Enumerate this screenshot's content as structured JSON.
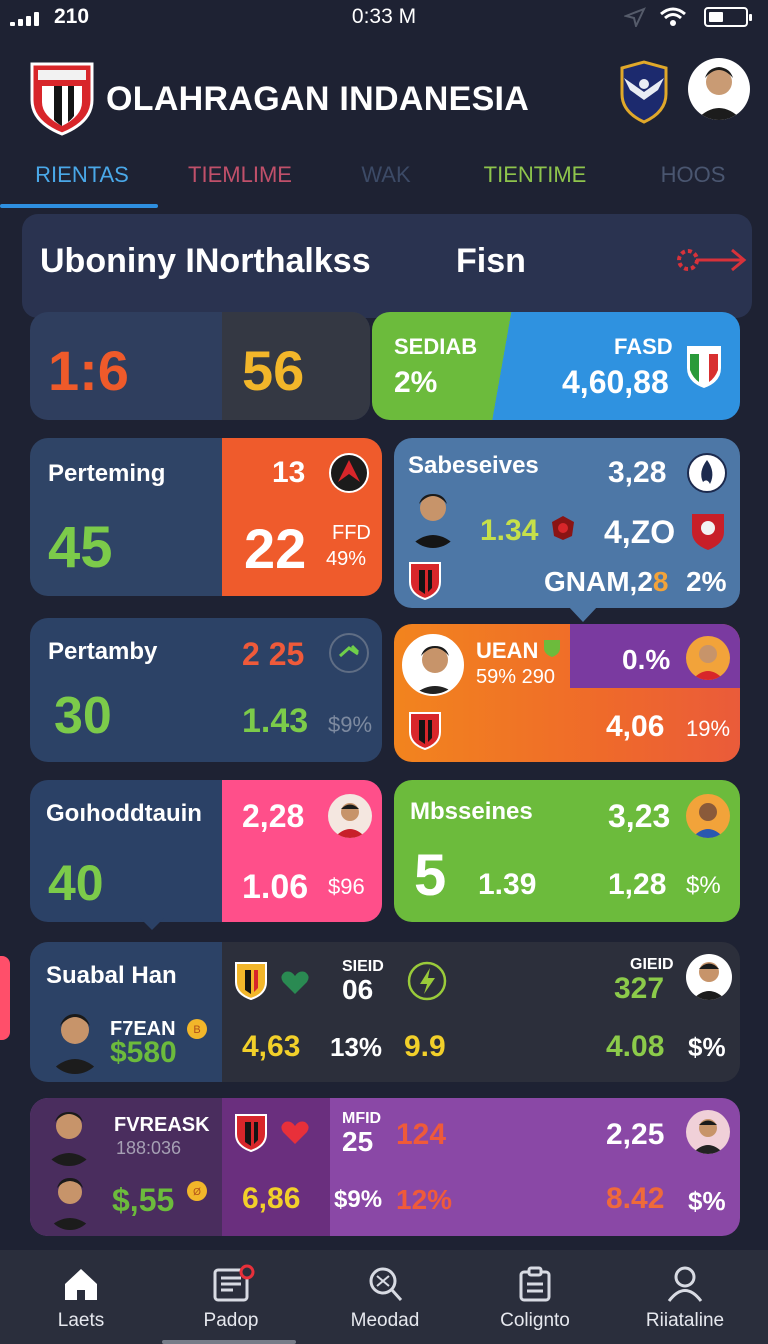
{
  "status_bar": {
    "carrier": "210",
    "time": "0:33 M",
    "battery_level_pct": 40
  },
  "header": {
    "title": "OLAHRAGAN INDANESIA",
    "logo_icon": "team-shield-icon",
    "badge_icon": "eagle-crest-icon",
    "profile_icon": "user-avatar"
  },
  "tabs": [
    {
      "label": "RIENTAS",
      "color": "#4aa8e8",
      "active": true
    },
    {
      "label": "TIEMLIME",
      "color": "#c0506a",
      "active": false
    },
    {
      "label": "WAK",
      "color": "#3c4a66",
      "active": false
    },
    {
      "label": "TIENTIME",
      "color": "#8ec44c",
      "active": false
    },
    {
      "label": "HOOS",
      "color": "#4a5670",
      "active": false
    }
  ],
  "banner": {
    "left": "Uboniny INorthalkss",
    "right": "Fisn",
    "action_icon": "arrow-right-icon"
  },
  "cards": {
    "row1_left": {
      "left_value": "1:6",
      "right_value": "56"
    },
    "row1_right": {
      "left_label": "SEDIAB",
      "left_value": "2%",
      "right_label": "FASD",
      "right_value": "4,60,88",
      "flag_icon": "italy-shield-icon"
    },
    "row2_left": {
      "title": "Perteming",
      "big": "45",
      "top_num": "13",
      "big_right": "22",
      "side_label": "FFD",
      "side_pct": "49%"
    },
    "row2_right": {
      "title": "Sabeseives",
      "v1": "3,28",
      "mid": "1.34",
      "v2": "4,ZO",
      "bottom": "GNAM,2",
      "bottom_hl": "8",
      "bottom_pct": "2%"
    },
    "row3_left": {
      "title": "Pertamby",
      "big": "30",
      "top_num": "2 25",
      "mid_num": "1.43",
      "pct": "$9%"
    },
    "row3_right": {
      "label": "UEAN",
      "sub": "59% 290",
      "pct_top": "0.%",
      "value": "4,06",
      "pct": "19%"
    },
    "row4_left": {
      "title": "Goıhoddtauin",
      "big": "40",
      "top_num": "2,28",
      "val": "1.06",
      "pct": "$96"
    },
    "row4_right": {
      "title": "Mbsseines",
      "top_num": "3,23",
      "big": "5",
      "mid": "1.39",
      "val": "1,28",
      "pct": "$%"
    },
    "row5": {
      "title": "Suabal Han",
      "name": "F7EAN",
      "price": "$580",
      "l1": "SIEID",
      "n1": "06",
      "l2": "GIEID",
      "n2": "327",
      "a": "4,63",
      "b": "13%",
      "c": "9.9",
      "d": "4.08",
      "e": "$%"
    },
    "row6": {
      "name": "FVREASK",
      "time": "188:036",
      "price": "$,55",
      "l1": "MFID",
      "n1": "25",
      "r1": "124",
      "v1": "2,25",
      "a": "6,86",
      "b": "$9%",
      "c": "12%",
      "d": "8.42",
      "e": "$%"
    }
  },
  "bottom_nav": [
    {
      "label": "Laets",
      "icon": "home-icon"
    },
    {
      "label": "Padop",
      "icon": "news-icon"
    },
    {
      "label": "Meodad",
      "icon": "search-icon"
    },
    {
      "label": "Colignto",
      "icon": "clipboard-icon"
    },
    {
      "label": "Riiataline",
      "icon": "profile-icon"
    }
  ]
}
